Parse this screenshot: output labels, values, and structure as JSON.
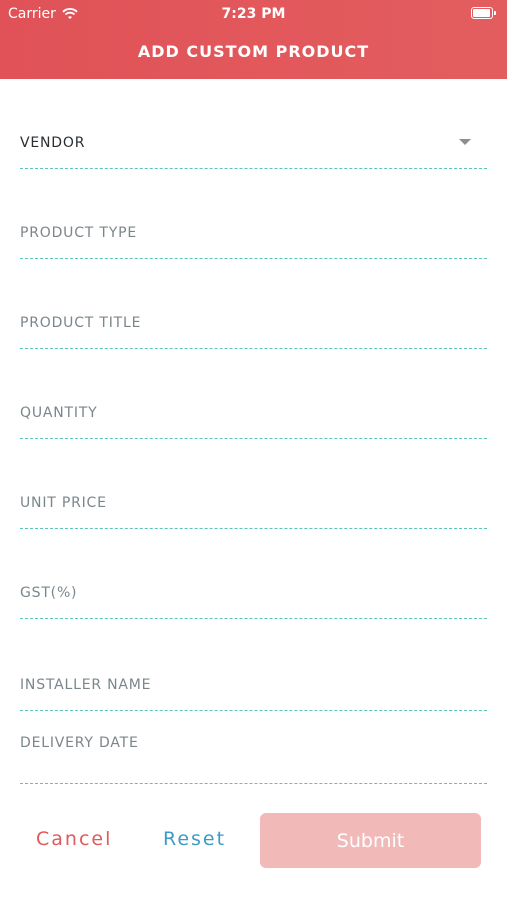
{
  "status_bar": {
    "carrier": "Carrier",
    "time": "7:23 PM"
  },
  "header": {
    "title": "ADD CUSTOM PRODUCT"
  },
  "form": {
    "fields": [
      {
        "label": "VENDOR",
        "type": "dropdown"
      },
      {
        "label": "PRODUCT TYPE",
        "type": "text"
      },
      {
        "label": "PRODUCT TITLE",
        "type": "text"
      },
      {
        "label": "QUANTITY",
        "type": "text"
      },
      {
        "label": "UNIT PRICE",
        "type": "text"
      },
      {
        "label": "GST(%)",
        "type": "text"
      },
      {
        "label": "INSTALLER NAME",
        "type": "text"
      },
      {
        "label": "DELIVERY DATE",
        "type": "text"
      }
    ]
  },
  "footer": {
    "cancel_label": "Cancel",
    "reset_label": "Reset",
    "submit_label": "Submit"
  },
  "colors": {
    "header_start": "#e05257",
    "header_end": "#e35d5f",
    "underline": "#5cc5b6",
    "label": "#7b868b",
    "cancel": "#e05a5a",
    "reset": "#3a9cc6",
    "submit_bg": "#f2b9b9"
  },
  "icons": {
    "wifi": "wifi-icon",
    "battery": "battery-icon",
    "dropdown": "chevron-down-icon"
  }
}
